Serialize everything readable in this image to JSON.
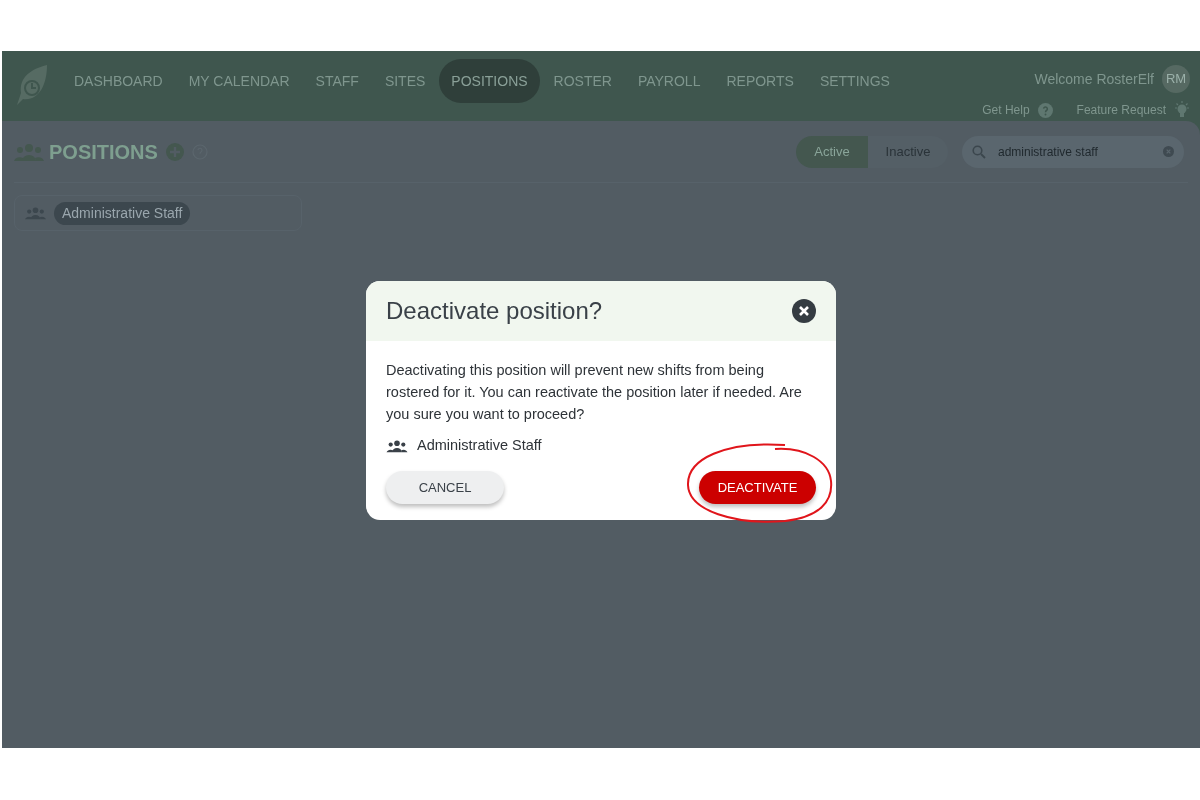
{
  "nav": {
    "items": [
      {
        "label": "DASHBOARD",
        "selected": false
      },
      {
        "label": "MY CALENDAR",
        "selected": false
      },
      {
        "label": "STAFF",
        "selected": false
      },
      {
        "label": "SITES",
        "selected": false
      },
      {
        "label": "POSITIONS",
        "selected": true
      },
      {
        "label": "ROSTER",
        "selected": false
      },
      {
        "label": "PAYROLL",
        "selected": false
      },
      {
        "label": "REPORTS",
        "selected": false
      },
      {
        "label": "SETTINGS",
        "selected": false
      }
    ],
    "welcome": "Welcome RosterElf",
    "avatar": "RM",
    "help": "Get Help",
    "feature": "Feature Request"
  },
  "page": {
    "title": "POSITIONS",
    "filters": [
      {
        "label": "Active",
        "selected": true
      },
      {
        "label": "Inactive",
        "selected": false
      }
    ],
    "search": {
      "value": "administrative staff"
    },
    "positions": [
      "Administrative Staff"
    ]
  },
  "dialog": {
    "title": "Deactivate position?",
    "message": "Deactivating this position will prevent new shifts from being rostered for it. You can reactivate the position later if needed. Are you sure you want to proceed?",
    "position": "Administrative Staff",
    "cancel": "CANCEL",
    "confirm": "DEACTIVATE",
    "confirm_highlighted": true
  }
}
